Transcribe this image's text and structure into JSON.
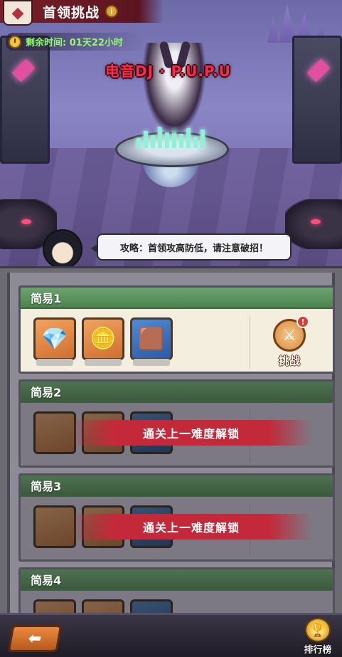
{
  "header": {
    "title": "首领挑战",
    "info_icon_glyph": "i",
    "timer_label": "剩余时间: 01天22小时"
  },
  "boss": {
    "name": "电音DJ · P.U.P.U"
  },
  "tip": {
    "text": "攻略：首领攻高防低，请注意破招！"
  },
  "levels": [
    {
      "name": "简易1",
      "locked": false,
      "rewards": [
        {
          "icon": "blue-crystal-icon",
          "glyph": "💎"
        },
        {
          "icon": "gold-ore-icon",
          "glyph": "🪙"
        },
        {
          "icon": "gold-nugget-icon",
          "glyph": "🟫"
        }
      ],
      "action_label": "挑战",
      "alert_glyph": "!"
    },
    {
      "name": "简易2",
      "locked": true,
      "lock_text": "通关上一难度解锁"
    },
    {
      "name": "简易3",
      "locked": true,
      "lock_text": "通关上一难度解锁"
    },
    {
      "name": "简易4",
      "locked": true
    }
  ],
  "bottom": {
    "rank_label": "排行榜"
  },
  "colors": {
    "header_bg": "#7a1f2a",
    "timer_text": "#8cff6a",
    "boss_name": "#ff2a4a",
    "level_header": "#4d8350",
    "lock_banner": "#c4293a",
    "back_button": "#e98a3f"
  }
}
